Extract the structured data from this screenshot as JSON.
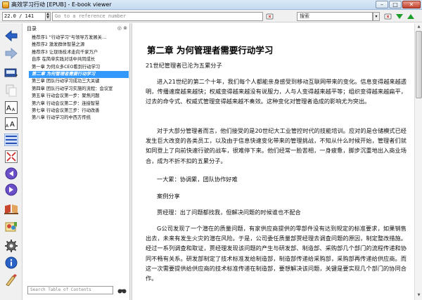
{
  "window": {
    "title": "高效学习行动 [EPUB] - E-book viewer",
    "minimize": "–",
    "maximize": "□",
    "close": "✕"
  },
  "toolbar": {
    "position": "22.0 / 141",
    "reference_placeholder": "Go to a reference number",
    "search_label": "搜索",
    "search_dropdown": "▾"
  },
  "toc": {
    "label": "目录",
    "controls": "◎ ⊗",
    "items": [
      "推荐序1 \"行动学习\"与领导方发展关…",
      "推荐序2 激发群体智慧之源",
      "推荐序3 让现场技术走向千家万户",
      "自序 在简单实践对话中共同成长",
      "第一章 为何众多CEO看到行动学习",
      "第二章 为何管理者需要行动学习",
      "第三章 团队行动学习成功三大关键",
      "第四章 团队行动学习实施的流程：会议室",
      "第五章 行动会议第一步：聚焦问题",
      "第六章 行动会议第二步：连接智慧",
      "第七章 行动会议第三步：行动改善",
      "第八章 行动学习的中西方传统"
    ],
    "search_placeholder": "Search Table of Contents"
  },
  "content": {
    "chapter_title": "第二章 为何管理者需要行动学习",
    "subtitle": "21世纪管理者已沦为五累分子",
    "para1": "进入21世纪的第二个十年，我们每个人都能亲身感受到移动互联网带来的变化。信息变得越来越透明，传播速度越来越快；权威变得越来越没有说服力，人与人变得越来越平等；组织变得越来越扁平，过去的命令式、权威式管理变得越来越不奏效。这种变化对管理者造成的影响尤为突出。",
    "para2": "对于大部分管理者而言，他们接受的是20世纪大工业管控时代的技能培训。应对的是仓储模式已经发生巨大改变的各类员工，以及由于信息快速变化带来的管理挑战，不知从什么时候开始，管理者们就如同登上了向前快速行驶的战车，很难停下来。他们经常一脸苦相，一身疲惫，脚步沉重地出入商业场合，成为不折不扣的五累分子。",
    "line1": "一大累：协调累，团队协作好难",
    "line2": "案例分享",
    "line3": "贾经理：出了问题都找我，但解决问题的时候谁也不配合",
    "para3": "G公司发现了一个潜在的质量问题，有家供应商提供的零部件没有达到规定的标准要求，如果销售出去，未来有发生火灾的潜在风险。于是，公司委任质量部贾经理去调查问题的原因，制定整改措施。经过一系列调查和取证，贾经理发现该问题的产生与研发部、制造部、采购部几个部门的流程传递和协同不畅有关系。研发部制定了技术标准发给制造部，制造部传递给采购部，采购部再传递给供应商。而这一次需要提供给供应商的技术标准传递在制造部，要想解决该问题，关键是要实现几个部门的协同合作。"
  },
  "scroll": {
    "up": "▲",
    "down": "▼"
  },
  "colors": {
    "toc_active": "#3399ff",
    "titlebar": "#c4daf1",
    "accent_green": "#1e9e2a",
    "accent_blue": "#2a62c8"
  }
}
